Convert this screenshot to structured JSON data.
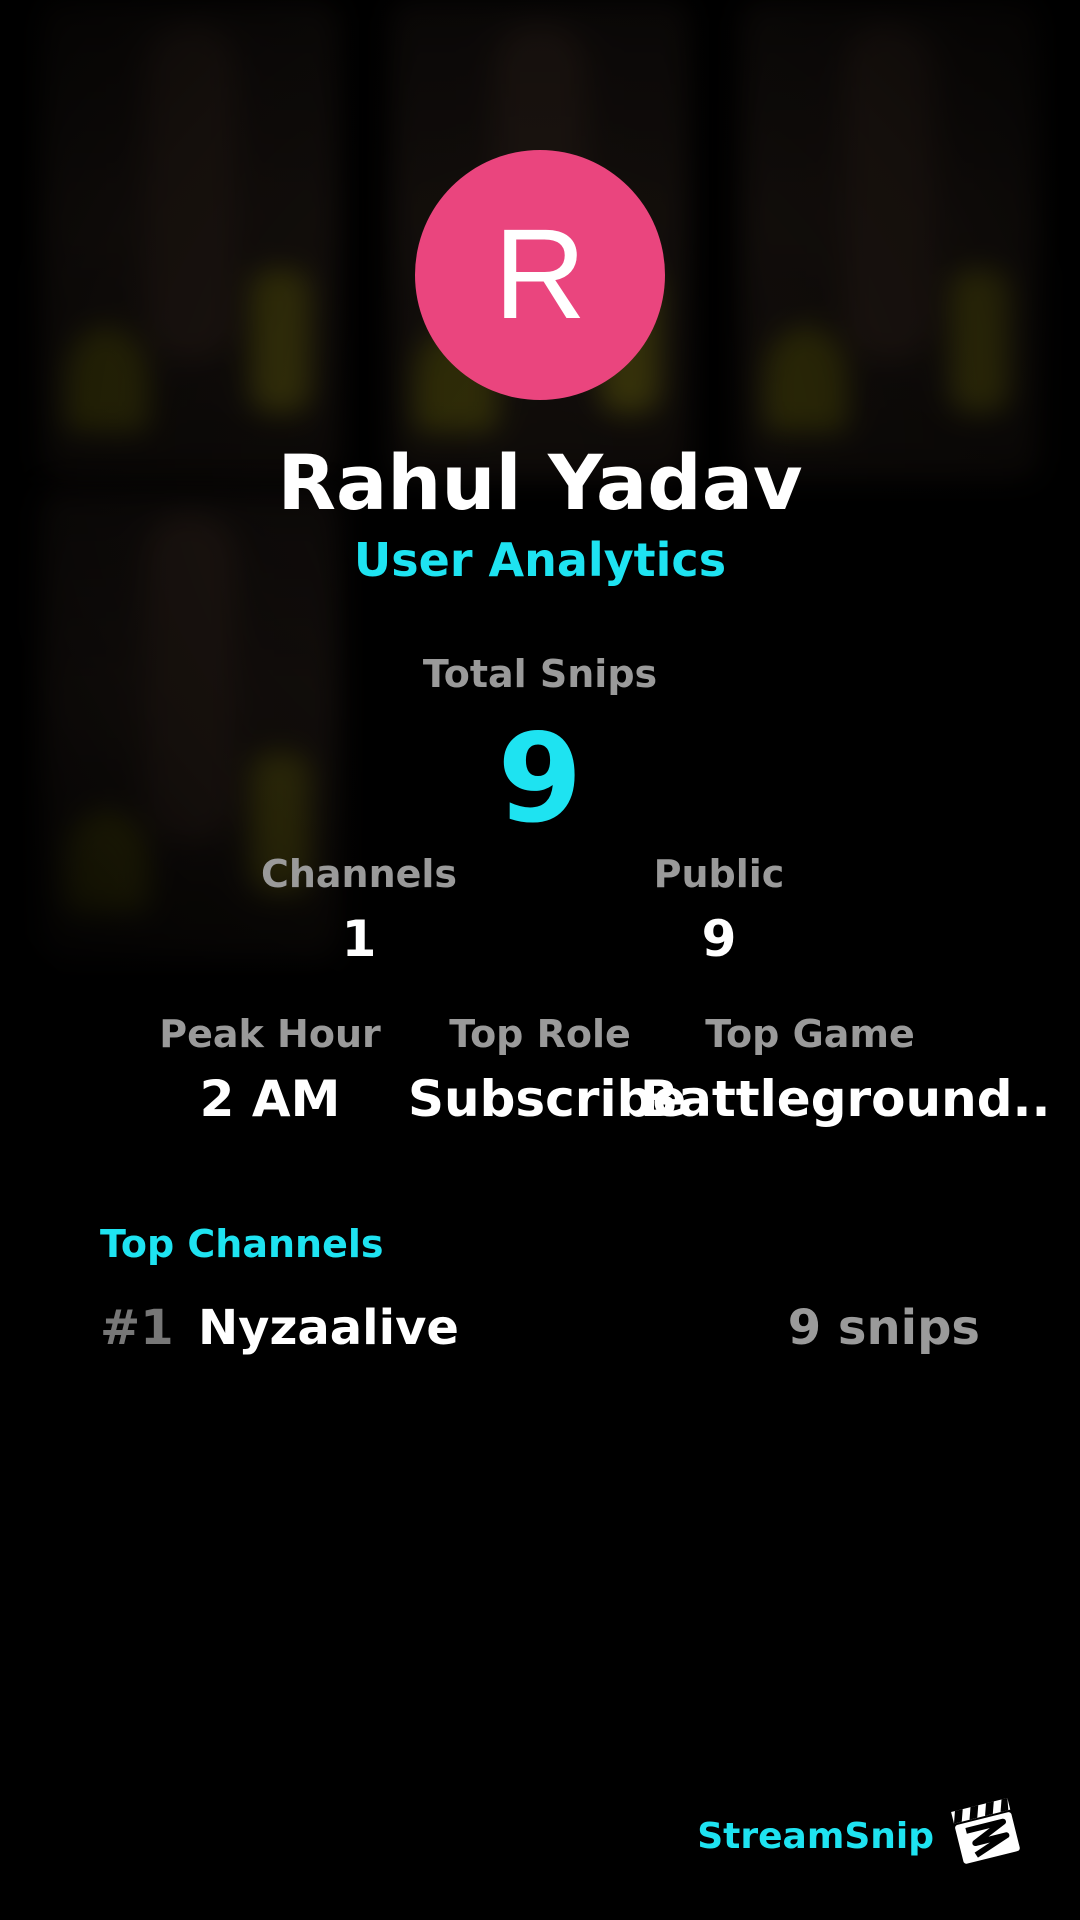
{
  "profile": {
    "initial": "R",
    "name": "Rahul Yadav",
    "subtitle": "User Analytics",
    "avatar_color": "#ea457e"
  },
  "stats": {
    "total_label": "Total Snips",
    "total_value": "9",
    "channels_label": "Channels",
    "channels_value": "1",
    "public_label": "Public",
    "public_value": "9",
    "peak_label": "Peak Hour",
    "peak_value": "2 AM",
    "role_label": "Top Role",
    "role_value": "Subscribe",
    "game_label": "Top Game",
    "game_value": "Battleground.."
  },
  "top_channels": {
    "title": "Top Channels",
    "items": [
      {
        "rank": "#1",
        "name": "Nyzaalive",
        "count": "9 snips"
      }
    ]
  },
  "footer": {
    "brand": "StreamSnip",
    "logo_icon": "clapperboard-icon"
  },
  "colors": {
    "accent": "#1ee3f1",
    "muted": "#9a9a9a",
    "background": "#000000"
  }
}
